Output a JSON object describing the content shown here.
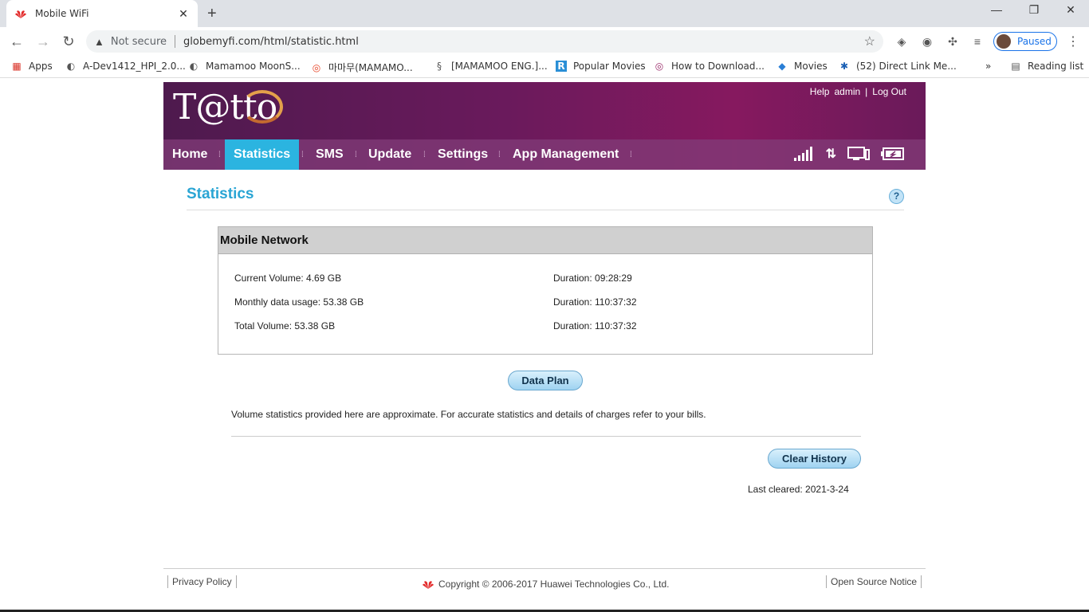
{
  "browser": {
    "tab_title": "Mobile WiFi",
    "new_tab": "+",
    "security_label": "Not secure",
    "url": "globemyfi.com/html/statistic.html",
    "profile_status": "Paused",
    "bookmarks": [
      "Apps",
      "A-Dev1412_HPI_2.0...",
      "Mamamoo MoonS...",
      "마마무(MAMAMO...",
      "[MAMAMOO ENG.]...",
      "Popular Movies",
      "How to Download...",
      "Movies",
      "(52) Direct Link Me..."
    ],
    "more_bookmarks": "»",
    "reading_list": "Reading list"
  },
  "header": {
    "logo_text": "T@tt",
    "logo_tail": "o",
    "links": [
      "Help",
      "admin",
      "Log Out"
    ],
    "nav": [
      "Home",
      "Statistics",
      "SMS",
      "Update",
      "Settings",
      "App Management"
    ],
    "active_nav": "Statistics",
    "status_icons": [
      "signal-icon",
      "data-transfer-icon",
      "device-icon",
      "battery-icon"
    ]
  },
  "page": {
    "title": "Statistics",
    "help_symbol": "?"
  },
  "mobile_network": {
    "heading": "Mobile Network",
    "rows": [
      {
        "volume": "Current Volume: 4.69 GB",
        "duration": "Duration: 09:28:29"
      },
      {
        "volume": "Monthly data usage: 53.38 GB",
        "duration": "Duration: 110:37:32"
      },
      {
        "volume": "Total Volume: 53.38 GB",
        "duration": "Duration: 110:37:32"
      }
    ]
  },
  "actions": {
    "data_plan": "Data Plan",
    "clear_history": "Clear History"
  },
  "note": "Volume statistics provided here are approximate. For accurate statistics and details of charges refer to your bills.",
  "last_cleared": "Last cleared: 2021-3-24",
  "footer": {
    "privacy": "Privacy Policy",
    "copyright": "Copyright © 2006-2017 Huawei Technologies Co., Ltd.",
    "open_source": "Open Source Notice"
  },
  "colors": {
    "accent": "#2aa5d4",
    "header_purple": "#6a1a5c",
    "active_tab": "#2bb4e0"
  }
}
